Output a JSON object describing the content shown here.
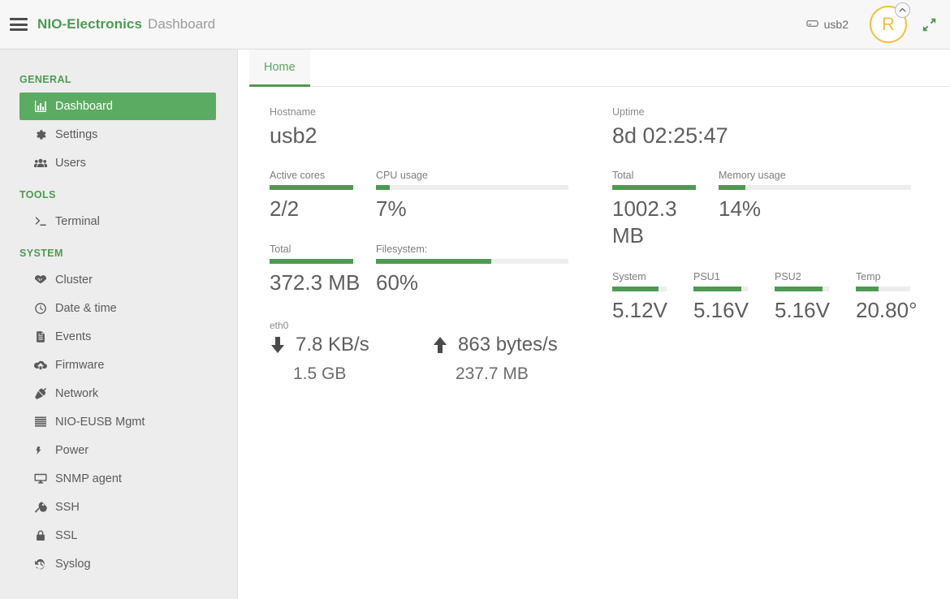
{
  "header": {
    "menu_icon": "hamburger-icon",
    "brand_name": "NIO-Electronics",
    "brand_sub": "Dashboard",
    "disk_icon": "hdd-icon",
    "disk_label": "usb2",
    "avatar_initial": "R",
    "avatar_badge_icon": "chevron-up-circle-icon",
    "expand_icon": "expand-arrows-icon",
    "accent_green": "#4d9a52",
    "avatar_color": "#f0c040"
  },
  "sidebar": {
    "sections": [
      {
        "title": "GENERAL",
        "items": [
          {
            "label": "Dashboard",
            "icon": "chart-bar-icon",
            "active": true
          },
          {
            "label": "Settings",
            "icon": "gear-icon",
            "active": false
          },
          {
            "label": "Users",
            "icon": "users-icon",
            "active": false
          }
        ]
      },
      {
        "title": "TOOLS",
        "items": [
          {
            "label": "Terminal",
            "icon": "terminal-icon",
            "active": false
          }
        ]
      },
      {
        "title": "SYSTEM",
        "items": [
          {
            "label": "Cluster",
            "icon": "heartbeat-icon",
            "active": false
          },
          {
            "label": "Date & time",
            "icon": "clock-icon",
            "active": false
          },
          {
            "label": "Events",
            "icon": "file-text-icon",
            "active": false
          },
          {
            "label": "Firmware",
            "icon": "cloud-upload-icon",
            "active": false
          },
          {
            "label": "Network",
            "icon": "plug-icon",
            "active": false
          },
          {
            "label": "NIO-EUSB Mgmt",
            "icon": "server-icon",
            "active": false
          },
          {
            "label": "Power",
            "icon": "bolt-icon",
            "active": false
          },
          {
            "label": "SNMP agent",
            "icon": "desktop-icon",
            "active": false
          },
          {
            "label": "SSH",
            "icon": "key-icon",
            "active": false
          },
          {
            "label": "SSL",
            "icon": "lock-icon",
            "active": false
          },
          {
            "label": "Syslog",
            "icon": "history-icon",
            "active": false
          }
        ]
      }
    ]
  },
  "main": {
    "tabs": [
      {
        "label": "Home",
        "active": true
      }
    ],
    "left": {
      "hostname_label": "Hostname",
      "hostname_value": "usb2",
      "metrics_row1": [
        {
          "label": "Active cores",
          "value": "2/2",
          "percent": 100
        },
        {
          "label": "CPU usage",
          "value": "7%",
          "percent": 7
        }
      ],
      "metrics_row2": [
        {
          "label": "Total",
          "value": "372.3 MB",
          "percent": 100
        },
        {
          "label": "Filesystem:",
          "value": "60%",
          "percent": 60
        }
      ],
      "network": {
        "interface": "eth0",
        "down_icon": "arrow-down-icon",
        "down_rate": "7.8 KB/s",
        "down_total": "1.5 GB",
        "up_icon": "arrow-up-icon",
        "up_rate": "863 bytes/s",
        "up_total": "237.7 MB"
      }
    },
    "right": {
      "uptime_label": "Uptime",
      "uptime_value": "8d 02:25:47",
      "metrics_row1": [
        {
          "label": "Total",
          "value": "1002.3 MB",
          "percent": 100
        },
        {
          "label": "Memory usage",
          "value": "14%",
          "percent": 14
        }
      ],
      "metrics_row2": [
        {
          "label": "System",
          "value": "5.12V",
          "percent": 85
        },
        {
          "label": "PSU1",
          "value": "5.16V",
          "percent": 88
        },
        {
          "label": "PSU2",
          "value": "5.16V",
          "percent": 88
        },
        {
          "label": "Temp",
          "value": "20.80°",
          "percent": 42
        }
      ]
    }
  }
}
